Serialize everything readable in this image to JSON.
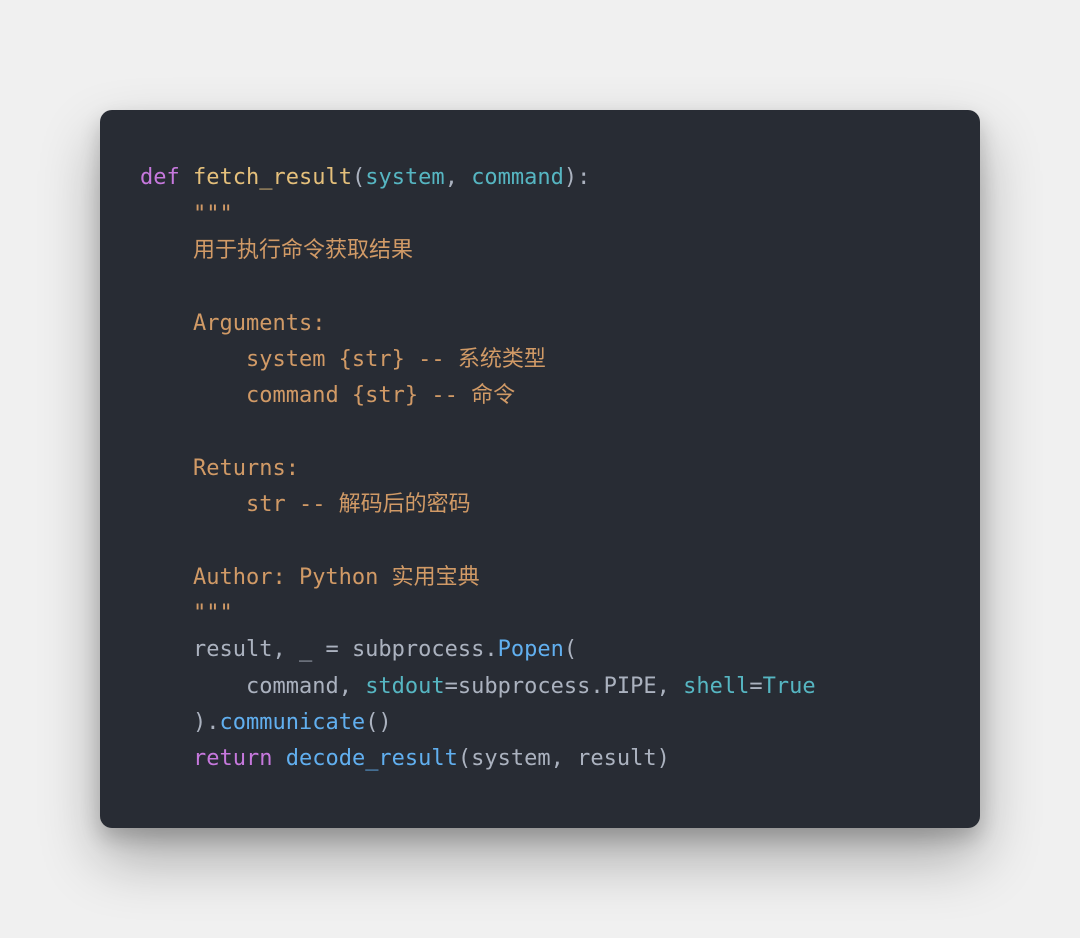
{
  "code": {
    "l1_def": "def",
    "l1_sp1": " ",
    "l1_fname": "fetch_result",
    "l1_open": "(",
    "l1_p1": "system",
    "l1_comma1": ", ",
    "l1_p2": "command",
    "l1_close": "):",
    "l2_indent": "    ",
    "l2_triple": "\"\"\"",
    "l3_indent": "    ",
    "l3_text": "用于执行命令获取结果",
    "l4_blank": "",
    "l5_indent": "    ",
    "l5_text": "Arguments:",
    "l6_indent": "        ",
    "l6_text": "system {str} -- 系统类型",
    "l7_indent": "        ",
    "l7_text": "command {str} -- 命令",
    "l8_blank": "",
    "l9_indent": "    ",
    "l9_text": "Returns:",
    "l10_indent": "        ",
    "l10_text": "str -- 解码后的密码",
    "l11_blank": "",
    "l12_indent": "    ",
    "l12_text": "Author: Python 实用宝典",
    "l13_indent": "    ",
    "l13_triple": "\"\"\"",
    "l14_indent": "    ",
    "l14_lhs": "result, _ ",
    "l14_eq": "= ",
    "l14_mod": "subprocess",
    "l14_dot1": ".",
    "l14_popen": "Popen",
    "l14_open": "(",
    "l15_indent": "        ",
    "l15_arg1": "command",
    "l15_comma1": ", ",
    "l15_kw1": "stdout",
    "l15_eq1": "=",
    "l15_val1a": "subprocess",
    "l15_val1dot": ".",
    "l15_val1b": "PIPE",
    "l15_comma2": ", ",
    "l15_kw2": "shell",
    "l15_eq2": "=",
    "l15_val2": "True",
    "l16_indent": "    ",
    "l16_close": ").",
    "l16_comm": "communicate",
    "l16_paren": "()",
    "l17_indent": "    ",
    "l17_return": "return",
    "l17_sp": " ",
    "l17_fn": "decode_result",
    "l17_open": "(",
    "l17_a1": "system",
    "l17_comma": ", ",
    "l17_a2": "result",
    "l17_close": ")"
  }
}
